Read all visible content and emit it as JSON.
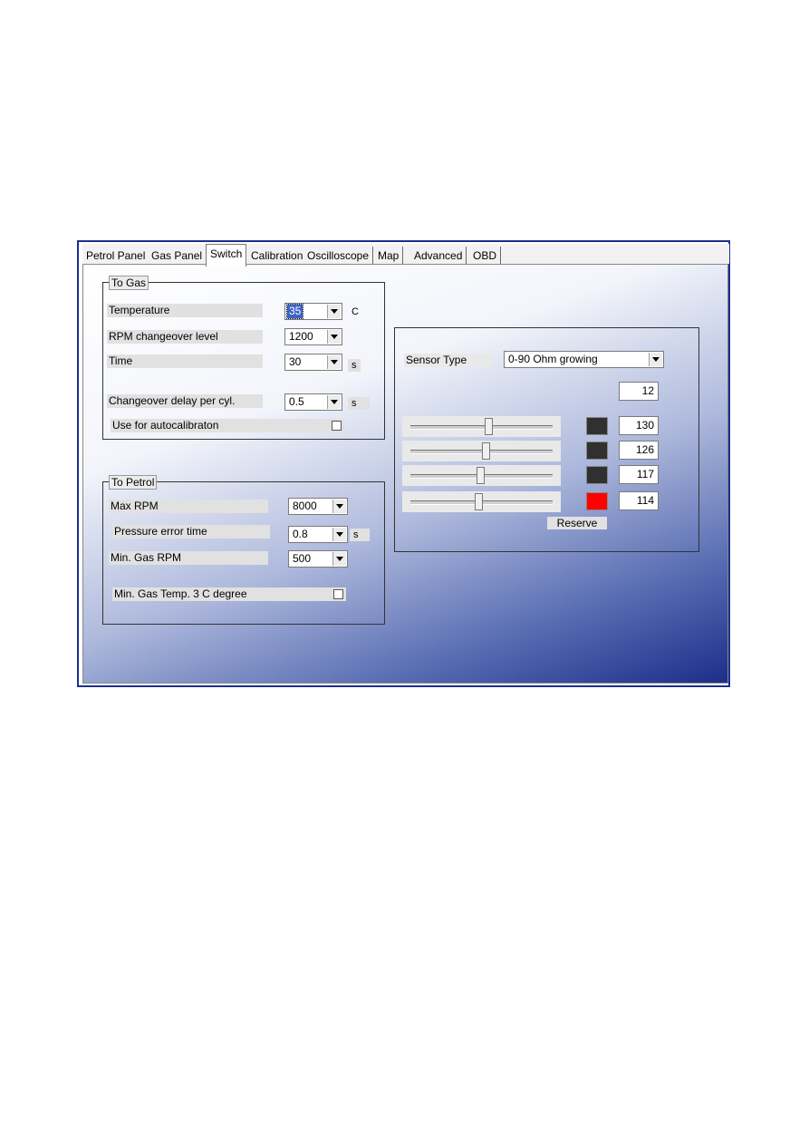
{
  "tabs": [
    "Petrol Panel",
    "Gas Panel",
    "Switch",
    "Calibration",
    "Oscilloscope",
    "Map",
    "Advanced",
    "OBD"
  ],
  "active_tab": "Switch",
  "to_gas": {
    "title": "To Gas",
    "temperature": {
      "label": "Temperature",
      "value": "35",
      "unit": "C"
    },
    "rpm_level": {
      "label": "RPM changeover level",
      "value": "1200"
    },
    "time": {
      "label": "Time",
      "value": "30",
      "unit": "s"
    },
    "delay": {
      "label": "Changeover delay per cyl.",
      "value": "0.5",
      "unit": "s"
    },
    "autocal": {
      "label": "Use for autocalibraton",
      "checked": false
    }
  },
  "to_petrol": {
    "title": "To Petrol",
    "max_rpm": {
      "label": "Max RPM",
      "value": "8000"
    },
    "pressure_error": {
      "label": "Pressure error time",
      "value": "0.8",
      "unit": "s"
    },
    "min_gas_rpm": {
      "label": "Min. Gas RPM",
      "value": "500"
    },
    "min_gas_temp": {
      "label": "Min. Gas Temp. 3 C degree",
      "checked": false
    }
  },
  "sensor": {
    "label": "Sensor Type",
    "value": "0-90 Ohm growing",
    "reading": "12",
    "levels": [
      {
        "value": "130",
        "position": 0.55,
        "color": "#303030"
      },
      {
        "value": "126",
        "position": 0.53,
        "color": "#303030"
      },
      {
        "value": "117",
        "position": 0.49,
        "color": "#303030"
      },
      {
        "value": "114",
        "position": 0.48,
        "color": "#ff0000"
      }
    ],
    "reserve_label": "Reserve"
  }
}
